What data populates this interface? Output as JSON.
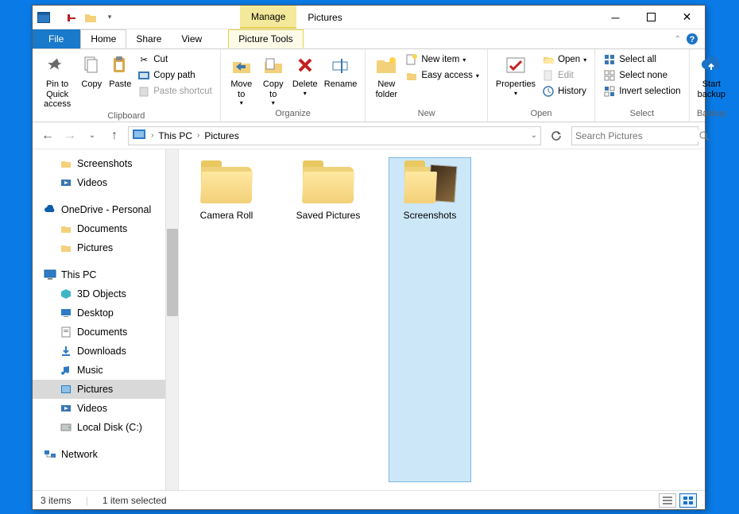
{
  "titlebar": {
    "context_tab": "Manage",
    "title": "Pictures"
  },
  "tabs": {
    "file": "File",
    "home": "Home",
    "share": "Share",
    "view": "View",
    "picture_tools": "Picture Tools"
  },
  "ribbon": {
    "clipboard": {
      "label": "Clipboard",
      "pin": "Pin to Quick\naccess",
      "copy": "Copy",
      "paste": "Paste",
      "cut": "Cut",
      "copy_path": "Copy path",
      "paste_shortcut": "Paste shortcut"
    },
    "organize": {
      "label": "Organize",
      "move_to": "Move\nto",
      "copy_to": "Copy\nto",
      "delete": "Delete",
      "rename": "Rename"
    },
    "new": {
      "label": "New",
      "new_folder": "New\nfolder",
      "new_item": "New item",
      "easy_access": "Easy access"
    },
    "open": {
      "label": "Open",
      "properties": "Properties",
      "open": "Open",
      "edit": "Edit",
      "history": "History"
    },
    "select": {
      "label": "Select",
      "select_all": "Select all",
      "select_none": "Select none",
      "invert": "Invert selection"
    },
    "backup": {
      "label": "Backup",
      "start": "Start\nbackup"
    }
  },
  "address": {
    "root": "This PC",
    "current": "Pictures"
  },
  "search": {
    "placeholder": "Search Pictures"
  },
  "nav": {
    "qa_screenshots": "Screenshots",
    "qa_videos": "Videos",
    "onedrive": "OneDrive - Personal",
    "od_documents": "Documents",
    "od_pictures": "Pictures",
    "this_pc": "This PC",
    "obj3d": "3D Objects",
    "desktop": "Desktop",
    "documents": "Documents",
    "downloads": "Downloads",
    "music": "Music",
    "pictures": "Pictures",
    "videos": "Videos",
    "local_disk": "Local Disk (C:)",
    "network": "Network"
  },
  "items": {
    "camera_roll": "Camera Roll",
    "saved_pictures": "Saved Pictures",
    "screenshots": "Screenshots"
  },
  "status": {
    "count": "3 items",
    "selected": "1 item selected"
  }
}
